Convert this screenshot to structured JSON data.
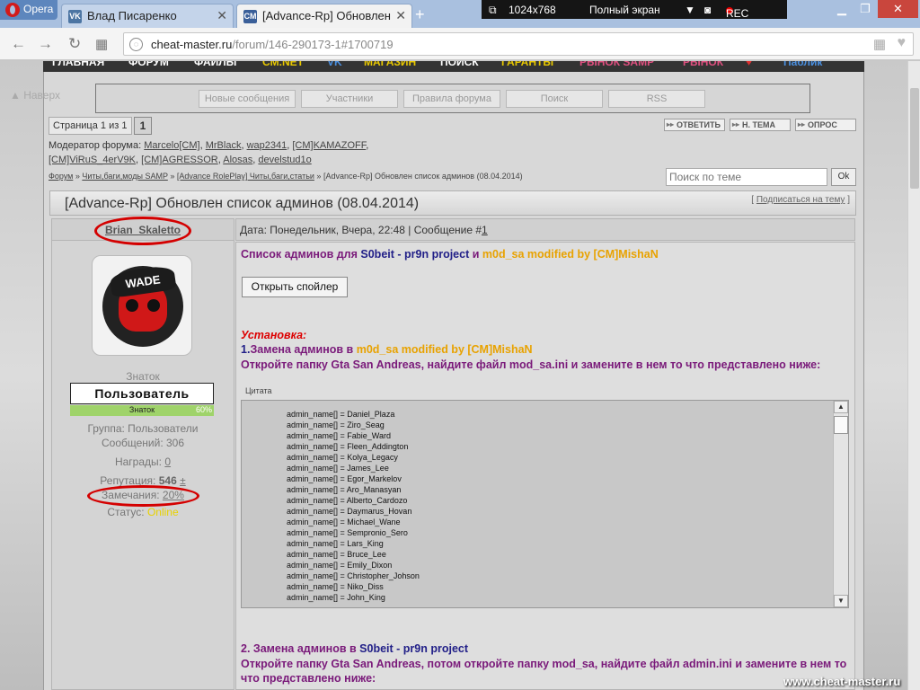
{
  "browser": {
    "opera_label": "Opera",
    "tabs": [
      {
        "favicon": "VK",
        "title": "Влад Писаренко"
      },
      {
        "favicon": "CM",
        "title": "[Advance-Rp] Обновлен"
      }
    ],
    "capture": {
      "resolution": "1024x768",
      "fullscreen": "Полный экран",
      "rec": "REC"
    },
    "url_domain": "cheat-master.ru",
    "url_path": "/forum/146-290173-1#1700719"
  },
  "site": {
    "nav": [
      "ГЛАВНАЯ",
      "ФОРУМ",
      "ФАЙЛЫ",
      "CM.NET",
      "VK",
      "МАГАЗИН",
      "ПОИСК",
      "ГАРАНТЫ",
      "РЫНОК SAMP",
      "РЫНОК",
      "♥",
      "Паблик"
    ],
    "back_link": "▲ Наверх",
    "subnav": [
      "Новые сообщения",
      "Участники",
      "Правила форума",
      "Поиск",
      "RSS"
    ],
    "pager": {
      "label": "Страница 1 из 1",
      "current": "1"
    },
    "actions": [
      "ОТВЕТИТЬ",
      "Н. ТЕМА",
      "ОПРОС"
    ],
    "moderators_label": "Модератор форума:",
    "moderators": [
      "Marcelo[CM]",
      "MrBlack",
      "wap2341",
      "[CM]KAMAZOFF",
      "[CM]ViRuS_4erV9K",
      "[CM]AGRESSOR",
      "Alosas",
      "develstud1o"
    ],
    "breadcrumbs": [
      "Форум",
      "Читы,баги,моды SAMP",
      "[Advance RolePlay] Читы,баги,статьи",
      "[Advance-Rp] Обновлен список админов (08.04.2014)"
    ],
    "search_placeholder": "Поиск по теме",
    "search_button": "Ok",
    "topic_title": "[Advance-Rp] Обновлен список админов (08.04.2014)",
    "subscribe": "Подписаться на тему",
    "watermark": "www.cheat-master.ru"
  },
  "author": {
    "name": "Brian_Skaletto",
    "avatar_text": "WADE",
    "rank": "Знаток",
    "badge": "Пользователь",
    "progress_label": "Знаток",
    "progress_pct": "60%",
    "group": "Группа: Пользователи",
    "posts": "Сообщений: 306",
    "awards_label": "Награды:",
    "awards": "0",
    "rep_label": "Репутация:",
    "rep": "546",
    "rep_pm": "±",
    "warn_label": "Замечания:",
    "warn": "20%",
    "status_label": "Статус:",
    "status": "Online"
  },
  "post": {
    "meta": "Дата: Понедельник, Вчера, 22:48 | Сообщение #",
    "num": "1",
    "intro": {
      "a": "Список админов для ",
      "b": "S0beit - pr9n project",
      "c": " и ",
      "d": "m0d_sa modified by [CM]MishaN"
    },
    "spoiler_button": "Открыть спойлер",
    "install": "Установка:",
    "step1": {
      "n": "1.",
      "a": "Замена админов в ",
      "b": "m0d_sa modified by [CM]MishaN"
    },
    "step1_text": "Откройте папку Gta San Andreas, найдите файл mod_sa.ini и замените в нем то что представлено ниже:",
    "quote_label": "Цитата",
    "admins": [
      "admin_name[] = Daniel_Plaza",
      "admin_name[] = Ziro_Seag",
      "admin_name[] = Fabie_Ward",
      "admin_name[] = Fleen_Addington",
      "admin_name[] = Kolya_Legacy",
      "admin_name[] = James_Lee",
      "admin_name[] = Egor_Markelov",
      "admin_name[] = Aro_Manasyan",
      "admin_name[] = Alberto_Cardozo",
      "admin_name[] = Daymarus_Hovan",
      "admin_name[] = Michael_Wane",
      "admin_name[] = Sempronio_Sero",
      "admin_name[] = Lars_King",
      "admin_name[] = Bruce_Lee",
      "admin_name[] = Emily_Dixon",
      "admin_name[] = Christopher_Johson",
      "admin_name[] = Niko_Diss",
      "admin_name[] = John_King"
    ],
    "step2": {
      "a": "2. Замена админов в ",
      "b": "S0beit - pr9n project"
    },
    "step2_text": "Откройте папку Gta San Andreas, потом откройте папку mod_sa, найдите файл admin.ini и замените в нем то что представлено ниже:"
  },
  "colors": {
    "purple": "#7a1a7a",
    "blue": "#222088",
    "orange": "#e8a200",
    "red_annotation": "#d40000"
  }
}
